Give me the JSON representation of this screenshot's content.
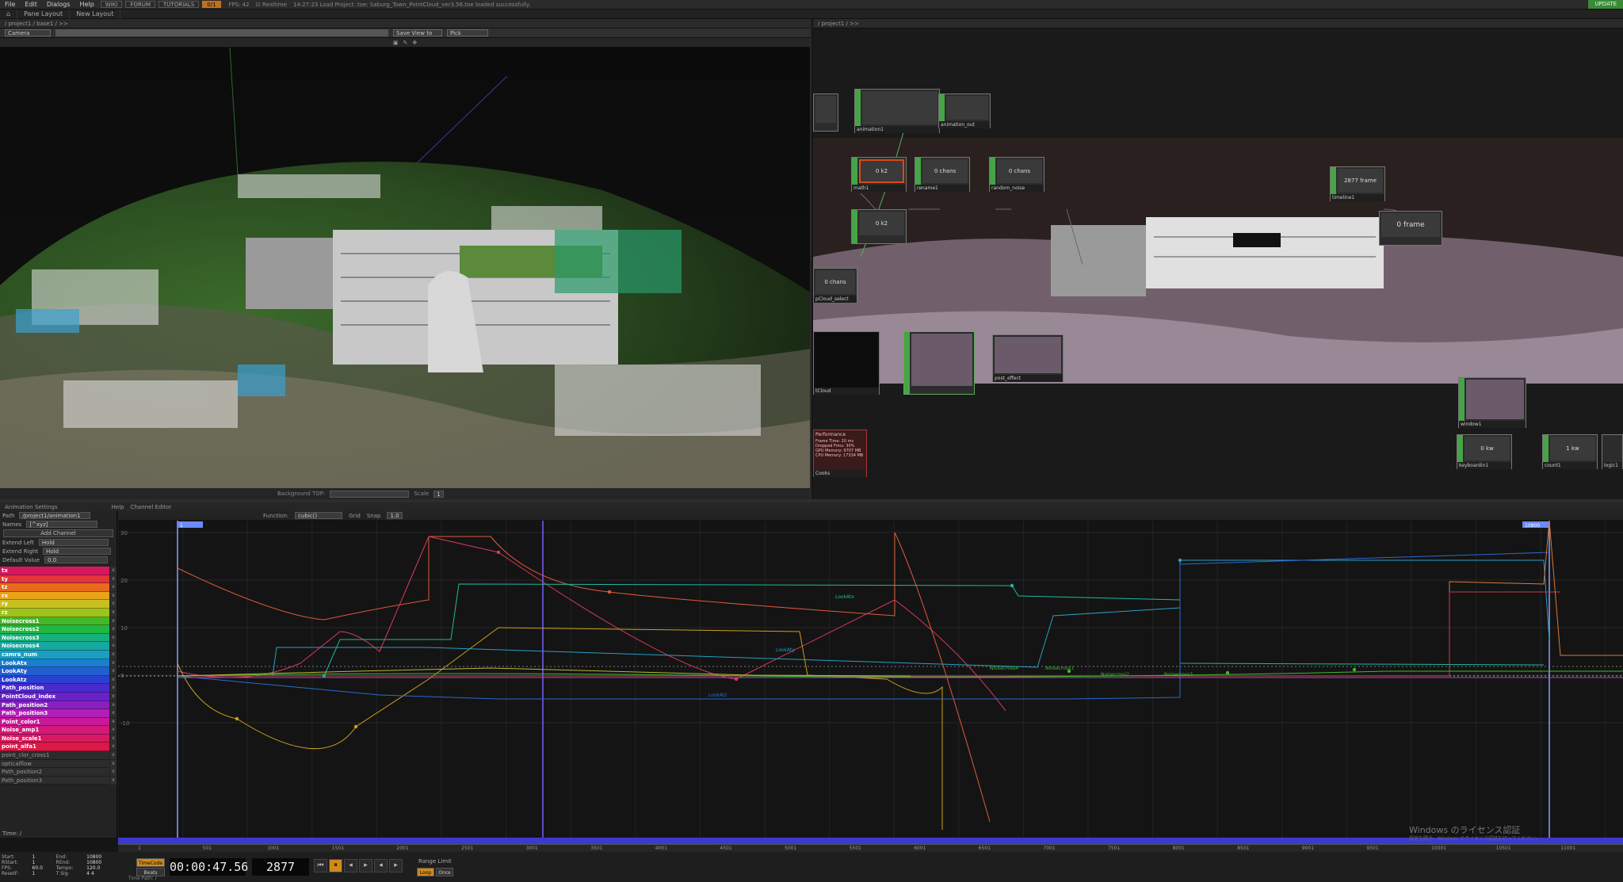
{
  "menu": {
    "items": [
      "File",
      "Edit",
      "Dialogs",
      "Help"
    ],
    "wiki": "WIKI",
    "forum": "FORUM",
    "tutorials": "TUTORIALS",
    "warn": "0/1",
    "fps_label": "FPS:",
    "fps_value": "42",
    "realtime": "Realtime",
    "status": "14:27:23 Load Project .toe: Saburg_Town_PointCloud_ver3.56.toe loaded successfully.",
    "update": "UPDATE"
  },
  "panebar": {
    "tab1": "Pane Layout",
    "tab2": "New Layout"
  },
  "viewer": {
    "path": "/ project1 / base1 / >>",
    "camera": "Camera",
    "save_view": "Save View to",
    "pick": "Pick",
    "background_top": "Background TOP:",
    "scale": "Scale",
    "scale_value": "1"
  },
  "network": {
    "path": "/ project1 / >>"
  },
  "nodes": {
    "animation1": "animation1",
    "animation_out": "animation_out",
    "math1": "math1",
    "math1_val": "0 k2",
    "rename1": "rename1",
    "rename1_val": "0 chans",
    "random_noise": "random_noise",
    "random_noise_val": "0 chans",
    "ch2_val": "0 k2",
    "select_lbl": "pCloud_select",
    "select_val": "0 chans",
    "timeline1": "timeline1",
    "timeline1_val": "2877 frame",
    "frame_val": "0 frame",
    "pointcloud": "tCloud",
    "post_effect": "post_effect",
    "perform": "Performance",
    "perform_lines": [
      "Frame Time: 20 ms",
      "Dropped Frms: 30%",
      "GPU Memory: 9707 MB",
      "CPU Memory: 17334 MB"
    ],
    "cooks": "Cooks",
    "window1": "window1",
    "keyboard": "keyboardin1",
    "keyboard_val": "0 kw",
    "count1": "count1",
    "count1_val": "1 kw",
    "logic": "logic1"
  },
  "channel_bar": {
    "anim_settings": "Animation Settings",
    "help": "Help",
    "editor": "Channel Editor"
  },
  "anim_panel": {
    "path_label": "Path",
    "path_value": "/project1/animation1",
    "names_label": "Names",
    "names_value": "[^xyz]",
    "add_channel": "Add Channel",
    "extend_left_label": "Extend Left",
    "extend_left_value": "Hold",
    "extend_right_label": "Extend Right",
    "extend_right_value": "Hold",
    "default_label": "Default Value",
    "default_value": "0.0",
    "time_label": "Time: /"
  },
  "channels": [
    {
      "name": "tx",
      "color": "#d8185c"
    },
    {
      "name": "ty",
      "color": "#e2343a"
    },
    {
      "name": "tz",
      "color": "#e86a1a"
    },
    {
      "name": "rx",
      "color": "#e8a317"
    },
    {
      "name": "ry",
      "color": "#c8c020"
    },
    {
      "name": "rz",
      "color": "#9cc41a"
    },
    {
      "name": "Noisecross1",
      "color": "#43b82a"
    },
    {
      "name": "Noisecross2",
      "color": "#20b840"
    },
    {
      "name": "Noisecross3",
      "color": "#16b07a"
    },
    {
      "name": "Noisecross4",
      "color": "#18a8a0"
    },
    {
      "name": "camra_num",
      "color": "#1a9ec4"
    },
    {
      "name": "LookAtx",
      "color": "#1b7ed0"
    },
    {
      "name": "LookAty",
      "color": "#2260d0"
    },
    {
      "name": "LookAtz",
      "color": "#2a40d0"
    },
    {
      "name": "Path_position",
      "color": "#4a2ad0"
    },
    {
      "name": "PointCloud_index",
      "color": "#6a22c8"
    },
    {
      "name": "Path_position2",
      "color": "#8a20c0"
    },
    {
      "name": "Path_position3",
      "color": "#b21eb8"
    },
    {
      "name": "Point_color1",
      "color": "#c8199a"
    },
    {
      "name": "Noise_amp1",
      "color": "#d2187a"
    },
    {
      "name": "Noise_scale1",
      "color": "#d81860"
    },
    {
      "name": "point_alfa1",
      "color": "#dc1846"
    },
    {
      "name": "point_clor_cross1",
      "color": "dim"
    },
    {
      "name": "opticalflow",
      "color": "dim"
    },
    {
      "name": "Path_position2",
      "color": "dim"
    },
    {
      "name": "Path_position3",
      "color": "dim"
    }
  ],
  "graph": {
    "function_label": "Function:",
    "function_value": "cubic()",
    "grid": "Grid",
    "snap": "Snap",
    "snap_value": "1.0",
    "start_marker": "1",
    "end_marker": "10800",
    "y_labels": [
      "30",
      "20",
      "10",
      "0",
      "-10"
    ],
    "curve_labels": [
      "LookAtx",
      "LookAty",
      "LookAtz",
      "Noisecross4",
      "Noisecross1",
      "Noisecross2",
      "Noisecross3"
    ]
  },
  "ruler": [
    "1",
    "501",
    "1001",
    "1501",
    "2001",
    "2501",
    "3001",
    "3501",
    "4001",
    "4501",
    "5001",
    "5501",
    "6001",
    "6501",
    "7001",
    "7501",
    "8001",
    "8501",
    "9001",
    "9501",
    "10001",
    "10501",
    "11001"
  ],
  "bottom": {
    "start_label": "Start:",
    "start": "1",
    "end_label": "End:",
    "end": "10800",
    "rstart_label": "RStart:",
    "rstart": "1",
    "rend_label": "REnd:",
    "rend": "10800",
    "fps_label": "FPS:",
    "fps": "60.0",
    "tempo_label": "Tempo:",
    "tempo": "120.0",
    "resetf_label": "ResetF:",
    "resetf": "1",
    "tsig_label": "T Sig:",
    "tsig1": "4",
    "tsig2": "4",
    "timecode_btn": "TimeCode",
    "beats_btn": "Beats",
    "timecode": "00:00:47.56",
    "frame": "2877",
    "range_limit": "Range Limit",
    "loop": "Loop",
    "once": "Once",
    "time_path": "Time Path: /"
  },
  "windows": {
    "line1": "Windows のライセンス認証",
    "line2": "設定を開き、Windows のライセンス認証を行ってください。"
  }
}
